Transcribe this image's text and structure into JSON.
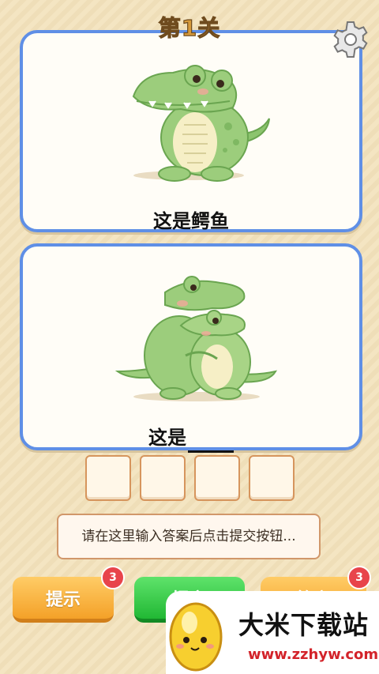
{
  "header": {
    "level_title": "第1关",
    "settings_icon": "gear-icon"
  },
  "cards": [
    {
      "caption": "这是鳄鱼",
      "image": "single-crocodile-illustration"
    },
    {
      "caption_prefix": "这是",
      "blank": "____",
      "image": "two-crocodiles-hugging-illustration"
    }
  ],
  "answer": {
    "box_count": 4,
    "placeholder": "请在这里输入答案后点击提交按钮..."
  },
  "buttons": {
    "hint_label": "提示",
    "hint_count": "3",
    "submit_label": "提交",
    "answer_label": "答案",
    "answer_count": "3"
  },
  "watermark": {
    "name": "大米下载站",
    "url": "www.zzhyw.com"
  },
  "colors": {
    "card_border": "#5f8fe6",
    "background": "#f3e2bb",
    "hint_button": "#f4a128",
    "submit_button": "#21b834",
    "badge": "#e8444b",
    "watermark_url": "#d3232a"
  }
}
